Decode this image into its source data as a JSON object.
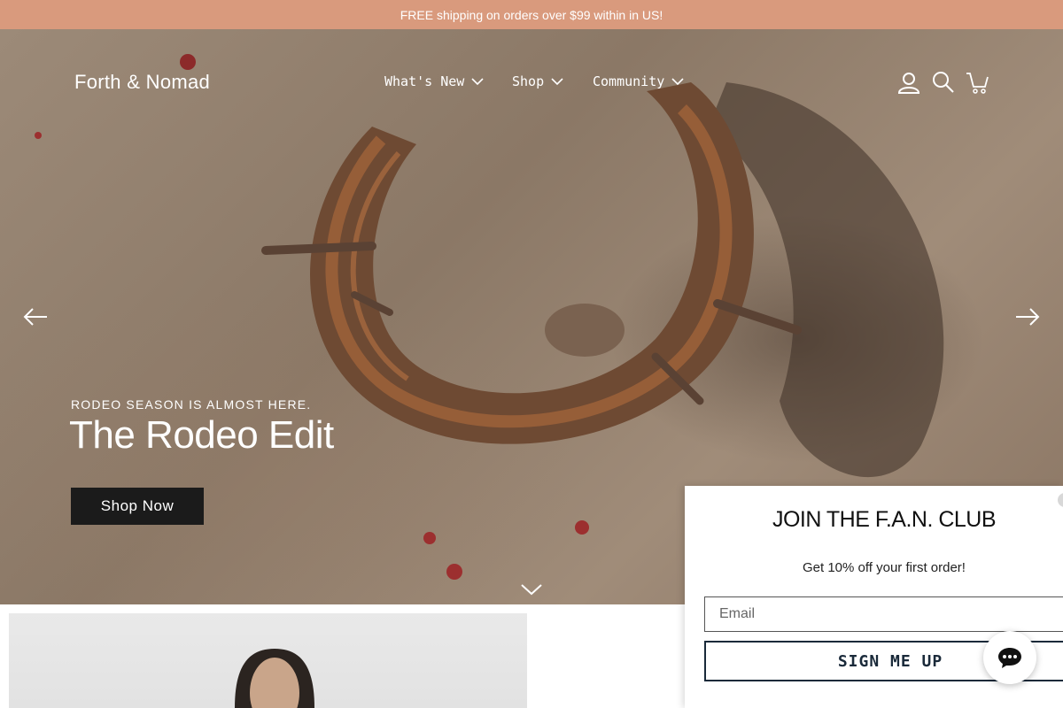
{
  "announcement": "FREE shipping on orders over $99 within in US!",
  "header": {
    "logo": "Forth & Nomad",
    "nav": [
      {
        "label": "What's New"
      },
      {
        "label": "Shop"
      },
      {
        "label": "Community"
      }
    ],
    "icons": [
      "account-icon",
      "search-icon",
      "cart-icon"
    ]
  },
  "hero": {
    "eyebrow": "RODEO SEASON IS ALMOST HERE.",
    "headline": "The Rodeo Edit",
    "cta": "Shop Now"
  },
  "popup": {
    "title": "JOIN THE F.A.N. CLUB",
    "subtitle": "Get 10% off your first order!",
    "email_placeholder": "Email",
    "submit_label": "SIGN ME UP"
  },
  "colors": {
    "announcement_bg": "#d99a7d",
    "cta_bg": "#1b1b1b",
    "signup_border": "#1a2a3a"
  }
}
